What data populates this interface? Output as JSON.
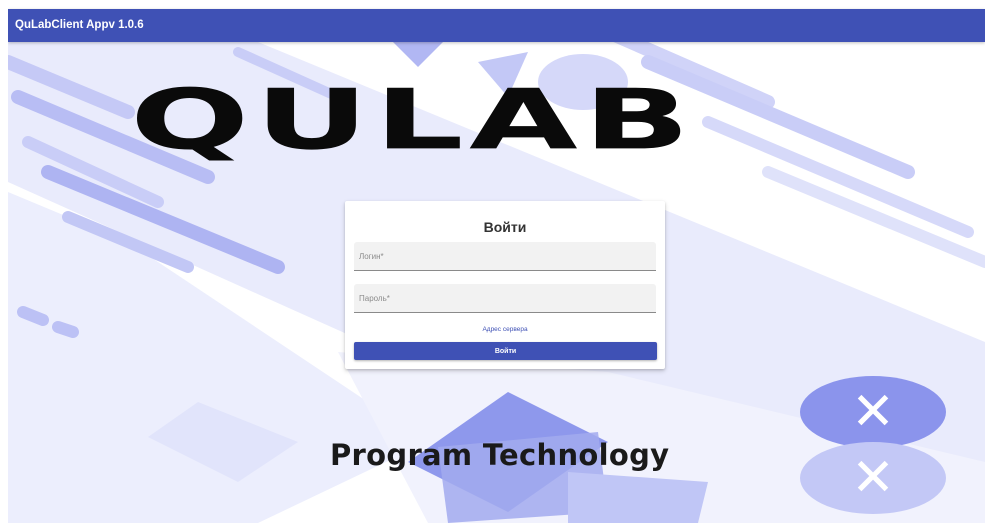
{
  "window": {
    "title": "QuLabClient Appv 1.0.6"
  },
  "branding": {
    "logo_text": "QULAB",
    "tagline": "Program Technology"
  },
  "login_form": {
    "title": "Войти",
    "login_placeholder": "Логин*",
    "password_placeholder": "Пароль*",
    "server_link": "Адрес сервера",
    "submit_label": "Войти"
  },
  "decor": {
    "close_glyph": "✕"
  },
  "colors": {
    "primary": "#3f51b5",
    "decor_light": "#dcdffb",
    "decor_mid": "#a9b0f2",
    "decor_dark": "#7f89ea"
  }
}
